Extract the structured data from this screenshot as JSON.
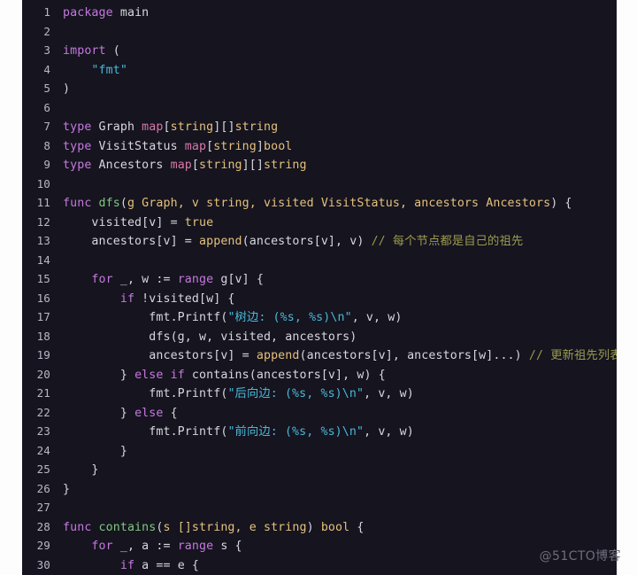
{
  "editor": {
    "language": "go",
    "theme_background": "#15141f",
    "page_background": "#fdfdfd",
    "gutter_color": "#b9b7c6",
    "colors": {
      "keyword": "#c678dd",
      "function": "#80c77e",
      "identifier": "#d7d7e0",
      "map_keyword": "#d878a8",
      "builtin": "#e5c07b",
      "string": "#4ab8d8",
      "comment": "#9a9a4d"
    },
    "first_line_number": 1,
    "last_line_number": 30,
    "lines": [
      {
        "n": "1",
        "tokens": [
          {
            "t": "package",
            "c": "kw"
          },
          {
            "t": " ",
            "c": "pl"
          },
          {
            "t": "main",
            "c": "pl"
          }
        ]
      },
      {
        "n": "2",
        "tokens": []
      },
      {
        "n": "3",
        "tokens": [
          {
            "t": "import",
            "c": "kw"
          },
          {
            "t": " (",
            "c": "punct"
          }
        ]
      },
      {
        "n": "4",
        "tokens": [
          {
            "t": "    ",
            "c": "pl"
          },
          {
            "t": "\"fmt\"",
            "c": "str"
          }
        ]
      },
      {
        "n": "5",
        "tokens": [
          {
            "t": ")",
            "c": "punct"
          }
        ]
      },
      {
        "n": "6",
        "tokens": []
      },
      {
        "n": "7",
        "tokens": [
          {
            "t": "type",
            "c": "kw"
          },
          {
            "t": " Graph ",
            "c": "typ"
          },
          {
            "t": "map",
            "c": "map"
          },
          {
            "t": "[",
            "c": "punct"
          },
          {
            "t": "string",
            "c": "bi"
          },
          {
            "t": "][]",
            "c": "punct"
          },
          {
            "t": "string",
            "c": "bi"
          }
        ]
      },
      {
        "n": "8",
        "tokens": [
          {
            "t": "type",
            "c": "kw"
          },
          {
            "t": " VisitStatus ",
            "c": "typ"
          },
          {
            "t": "map",
            "c": "map"
          },
          {
            "t": "[",
            "c": "punct"
          },
          {
            "t": "string",
            "c": "bi"
          },
          {
            "t": "]",
            "c": "punct"
          },
          {
            "t": "bool",
            "c": "bi"
          }
        ]
      },
      {
        "n": "9",
        "tokens": [
          {
            "t": "type",
            "c": "kw"
          },
          {
            "t": " Ancestors ",
            "c": "typ"
          },
          {
            "t": "map",
            "c": "map"
          },
          {
            "t": "[",
            "c": "punct"
          },
          {
            "t": "string",
            "c": "bi"
          },
          {
            "t": "][]",
            "c": "punct"
          },
          {
            "t": "string",
            "c": "bi"
          }
        ]
      },
      {
        "n": "10",
        "tokens": []
      },
      {
        "n": "11",
        "tokens": [
          {
            "t": "func",
            "c": "kw"
          },
          {
            "t": " ",
            "c": "pl"
          },
          {
            "t": "dfs",
            "c": "fn"
          },
          {
            "t": "(",
            "c": "punct"
          },
          {
            "t": "g Graph, v string, visited VisitStatus, ancestors Ancestors",
            "c": "bi"
          },
          {
            "t": ") {",
            "c": "punct"
          }
        ]
      },
      {
        "n": "12",
        "tokens": [
          {
            "t": "    visited[v] = ",
            "c": "pl"
          },
          {
            "t": "true",
            "c": "bi"
          }
        ]
      },
      {
        "n": "13",
        "tokens": [
          {
            "t": "    ancestors[v] = ",
            "c": "pl"
          },
          {
            "t": "append",
            "c": "bi"
          },
          {
            "t": "(ancestors[v], v) ",
            "c": "pl"
          },
          {
            "t": "// 每个节点都是自己的祖先",
            "c": "cmt"
          }
        ]
      },
      {
        "n": "14",
        "tokens": []
      },
      {
        "n": "15",
        "tokens": [
          {
            "t": "    ",
            "c": "pl"
          },
          {
            "t": "for",
            "c": "kw"
          },
          {
            "t": " _, w := ",
            "c": "pl"
          },
          {
            "t": "range",
            "c": "kw"
          },
          {
            "t": " g[v] {",
            "c": "pl"
          }
        ]
      },
      {
        "n": "16",
        "tokens": [
          {
            "t": "        ",
            "c": "pl"
          },
          {
            "t": "if",
            "c": "kw"
          },
          {
            "t": " !visited[w] {",
            "c": "pl"
          }
        ]
      },
      {
        "n": "17",
        "tokens": [
          {
            "t": "            fmt.Printf(",
            "c": "pl"
          },
          {
            "t": "\"树边: (%s, %s)\\n\"",
            "c": "str"
          },
          {
            "t": ", v, w)",
            "c": "pl"
          }
        ]
      },
      {
        "n": "18",
        "tokens": [
          {
            "t": "            dfs(g, w, visited, ancestors)",
            "c": "pl"
          }
        ]
      },
      {
        "n": "19",
        "tokens": [
          {
            "t": "            ancestors[v] = ",
            "c": "pl"
          },
          {
            "t": "append",
            "c": "bi"
          },
          {
            "t": "(ancestors[v], ancestors[w]...) ",
            "c": "pl"
          },
          {
            "t": "// 更新祖先列表",
            "c": "cmt"
          }
        ]
      },
      {
        "n": "20",
        "tokens": [
          {
            "t": "        } ",
            "c": "pl"
          },
          {
            "t": "else",
            "c": "kw"
          },
          {
            "t": " ",
            "c": "pl"
          },
          {
            "t": "if",
            "c": "kw"
          },
          {
            "t": " contains(ancestors[v], w) {",
            "c": "pl"
          }
        ]
      },
      {
        "n": "21",
        "tokens": [
          {
            "t": "            fmt.Printf(",
            "c": "pl"
          },
          {
            "t": "\"后向边: (%s, %s)\\n\"",
            "c": "str"
          },
          {
            "t": ", v, w)",
            "c": "pl"
          }
        ]
      },
      {
        "n": "22",
        "tokens": [
          {
            "t": "        } ",
            "c": "pl"
          },
          {
            "t": "else",
            "c": "kw"
          },
          {
            "t": " {",
            "c": "pl"
          }
        ]
      },
      {
        "n": "23",
        "tokens": [
          {
            "t": "            fmt.Printf(",
            "c": "pl"
          },
          {
            "t": "\"前向边: (%s, %s)\\n\"",
            "c": "str"
          },
          {
            "t": ", v, w)",
            "c": "pl"
          }
        ]
      },
      {
        "n": "24",
        "tokens": [
          {
            "t": "        }",
            "c": "pl"
          }
        ]
      },
      {
        "n": "25",
        "tokens": [
          {
            "t": "    }",
            "c": "pl"
          }
        ]
      },
      {
        "n": "26",
        "tokens": [
          {
            "t": "}",
            "c": "pl"
          }
        ]
      },
      {
        "n": "27",
        "tokens": []
      },
      {
        "n": "28",
        "tokens": [
          {
            "t": "func",
            "c": "kw"
          },
          {
            "t": " ",
            "c": "pl"
          },
          {
            "t": "contains",
            "c": "fn"
          },
          {
            "t": "(",
            "c": "punct"
          },
          {
            "t": "s []string, e string",
            "c": "bi"
          },
          {
            "t": ") ",
            "c": "punct"
          },
          {
            "t": "bool",
            "c": "bi"
          },
          {
            "t": " {",
            "c": "punct"
          }
        ]
      },
      {
        "n": "29",
        "tokens": [
          {
            "t": "    ",
            "c": "pl"
          },
          {
            "t": "for",
            "c": "kw"
          },
          {
            "t": " _, a := ",
            "c": "pl"
          },
          {
            "t": "range",
            "c": "kw"
          },
          {
            "t": " s {",
            "c": "pl"
          }
        ]
      },
      {
        "n": "30",
        "tokens": [
          {
            "t": "        ",
            "c": "pl"
          },
          {
            "t": "if",
            "c": "kw"
          },
          {
            "t": " a == e {",
            "c": "pl"
          }
        ]
      }
    ]
  },
  "watermark": {
    "text": "@51CTO博客"
  }
}
